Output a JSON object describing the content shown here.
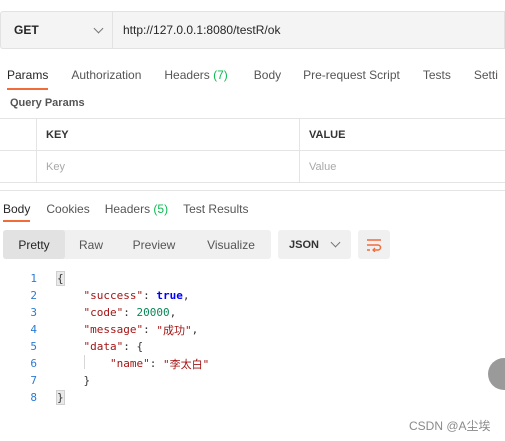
{
  "request": {
    "method": "GET",
    "url": "http://127.0.0.1:8080/testR/ok"
  },
  "request_tabs": [
    {
      "label": "Params",
      "active": true
    },
    {
      "label": "Authorization"
    },
    {
      "label": "Headers",
      "count": "(7)"
    },
    {
      "label": "Body"
    },
    {
      "label": "Pre-request Script"
    },
    {
      "label": "Tests"
    },
    {
      "label": "Setti"
    }
  ],
  "query_params": {
    "title": "Query Params",
    "columns": [
      "KEY",
      "VALUE"
    ],
    "placeholder_row": [
      "Key",
      "Value"
    ]
  },
  "response_tabs": [
    {
      "label": "Body",
      "active": true
    },
    {
      "label": "Cookies"
    },
    {
      "label": "Headers",
      "count": "(5)"
    },
    {
      "label": "Test Results"
    }
  ],
  "view_modes": [
    "Pretty",
    "Raw",
    "Preview",
    "Visualize"
  ],
  "active_view_mode": "Pretty",
  "format": "JSON",
  "code": {
    "line_numbers": [
      "1",
      "2",
      "3",
      "4",
      "5",
      "6",
      "7",
      "8"
    ],
    "open_brace": "{",
    "close_brace": "}",
    "success_key": "\"success\"",
    "success_value": "true",
    "code_key": "\"code\"",
    "code_value": "20000",
    "message_key": "\"message\"",
    "message_value": "\"成功\"",
    "data_key": "\"data\"",
    "name_key": "\"name\"",
    "name_value": "\"李太白\""
  },
  "watermark": "CSDN @A尘埃",
  "colors": {
    "accent": "#f26b3a",
    "count_green": "#0cbb52",
    "line_number": "#2b7bd1"
  }
}
